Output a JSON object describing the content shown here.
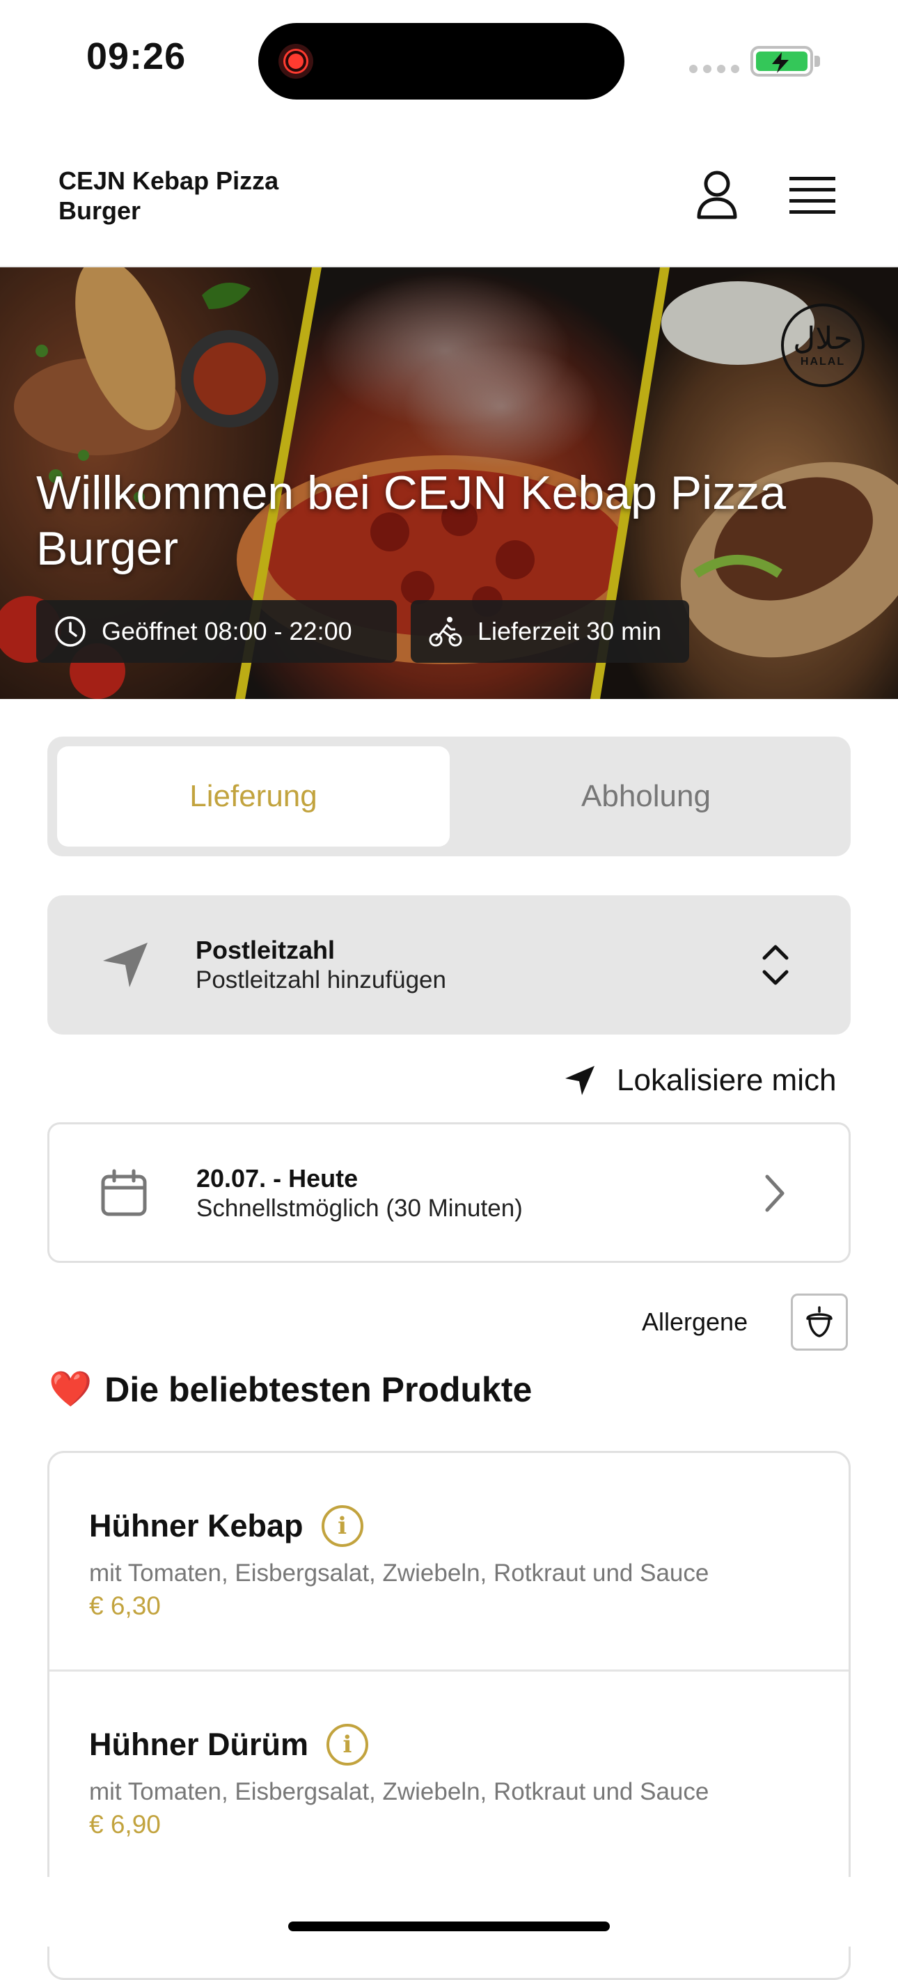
{
  "status_bar": {
    "time": "09:26"
  },
  "header": {
    "brand": "CEJN Kebap Pizza Burger"
  },
  "hero": {
    "title": "Willkommen bei CEJN Kebap Pizza Burger",
    "open_hours": "Geöffnet 08:00 - 22:00",
    "delivery_time": "Lieferzeit 30 min",
    "badge": {
      "arabic": "حلال",
      "latin": "HALAL"
    }
  },
  "order_mode": {
    "options": [
      "Lieferung",
      "Abholung"
    ],
    "selected": "Lieferung"
  },
  "postal": {
    "title": "Postleitzahl",
    "placeholder": "Postleitzahl hinzufügen"
  },
  "locate": {
    "label": "Lokalisiere mich"
  },
  "schedule": {
    "date": "20.07. - Heute",
    "time": "Schnellstmöglich (30 Minuten)"
  },
  "allergens": {
    "label": "Allergene"
  },
  "popular": {
    "emoji": "❤️",
    "title": "Die beliebtesten Produkte",
    "items": [
      {
        "name": "Hühner Kebap",
        "description": "mit Tomaten, Eisbergsalat, Zwiebeln, Rotkraut und Sauce",
        "price": "€ 6,30"
      },
      {
        "name": "Hühner Dürüm",
        "description": "mit Tomaten, Eisbergsalat, Zwiebeln, Rotkraut und Sauce",
        "price": "€ 6,90"
      }
    ]
  },
  "colors": {
    "accent": "#c2a33e",
    "panel": "#e6e6e6",
    "hero_stripe": "#e6d21a"
  },
  "icons": [
    "clock-icon",
    "bike-icon",
    "user-icon",
    "menu-icon",
    "location-arrow-icon",
    "chevron-updown-icon",
    "calendar-icon",
    "chevron-right-icon",
    "acorn-icon",
    "info-icon"
  ]
}
